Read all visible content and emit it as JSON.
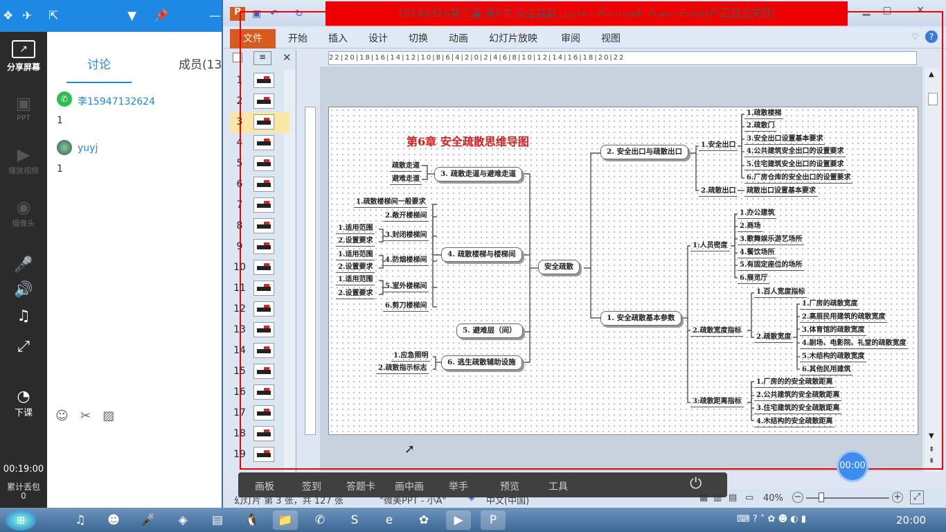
{
  "left_panel": {
    "share_label": "分享屏幕",
    "ppt_label": "PPT",
    "video_label": "播放视频",
    "camera_label": "摄像头",
    "end_class_label": "下课",
    "timer": "00:19:00",
    "subinfo1": "累计丢包",
    "subinfo2": "0",
    "tab_discuss": "讨论",
    "tab_members": "成员(13",
    "messages": [
      {
        "name": "李15947132624",
        "body": "1"
      },
      {
        "name": "yuyj",
        "body": "1"
      }
    ]
  },
  "ppt": {
    "window_title": "20180926第二篇 第6章 安全疏散 .pptx - Microsoft PowerPoint(产品激活失败)",
    "file_tab": "文件",
    "tabs": [
      "开始",
      "插入",
      "设计",
      "切换",
      "动画",
      "幻灯片放映",
      "审阅",
      "视图"
    ],
    "ruler_h": "22|20|18|16|14|12|10|8|6|4|2|0|2|4|6|8|10|12|14|16|18|20|22",
    "slide_numbers": [
      "1",
      "2",
      "3",
      "4",
      "5",
      "6",
      "7",
      "8",
      "9",
      "10",
      "11",
      "12",
      "13",
      "14",
      "15",
      "16",
      "17",
      "18",
      "19"
    ],
    "status": {
      "slide_info": "幻灯片 第 3 张，共 127 张",
      "theme": "\"微美PPT - 小A\"",
      "lang": "中文(中国)",
      "zoom": "40%"
    },
    "rec_timer": "00:00"
  },
  "bottom_bar": {
    "items": [
      "画板",
      "签到",
      "答题卡",
      "画中画",
      "举手",
      "预览",
      "工具"
    ]
  },
  "taskbar": {
    "clock": "20:00"
  },
  "mindmap": {
    "title": "第6章 安全疏散思维导图",
    "center": "安全疏散",
    "left_branches": {
      "b3": "3. 疏散走道与避难走道",
      "b3_children": [
        "疏散走道",
        "避难走道"
      ],
      "b4": "4. 疏散楼梯与楼梯间",
      "b4_children": [
        "1.疏散楼梯间一般要求",
        "2.敞开楼梯间",
        "3.封闭楼梯间",
        "4.防烟楼梯间",
        "5.室外楼梯间",
        "6.剪刀楼梯间"
      ],
      "b4_sub": [
        "1.适用范围",
        "2.设置要求",
        "1.适用范围",
        "2.设置要求",
        "1.适用范围",
        "2.设置要求"
      ],
      "b5": "5. 避难层（间）",
      "b6": "6. 逃生疏散辅助设施",
      "b6_children": [
        "1.应急照明",
        "2.疏散指示标志"
      ]
    },
    "right_branches": {
      "b2": "2. 安全出口与疏散出口",
      "b2_sub": [
        "1.安全出口",
        "2.疏散出口"
      ],
      "b2_exit": [
        "1.疏散楼梯",
        "2.疏散门",
        "3.安全出口设置基本要求",
        "4.公共建筑安全出口的设置要求",
        "5.住宅建筑安全出口的设置要求",
        "6.厂房仓库的安全出口的设置要求"
      ],
      "b2_evac": "疏散出口设置基本要求",
      "b1": "1. 安全疏散基本参数",
      "b1_sub": [
        "1:人员密度",
        "2.疏散宽度指标",
        "3:疏散距离指标"
      ],
      "density": [
        "1.办公建筑",
        "2.商场",
        "3.歌舞娱乐游艺场所",
        "4.餐饮场所",
        "5.有固定座位的场所",
        "6.展览厅"
      ],
      "width_sub": [
        "1.百人宽度指标",
        "2.疏散宽度"
      ],
      "width_items": [
        "1.厂房的疏散宽度",
        "2.高层民用建筑的疏散宽度",
        "3.体育馆的疏散宽度",
        "4.剧场、电影院、礼堂的疏散宽度",
        "5.木结构的疏散宽度",
        "6.其他民用建筑"
      ],
      "distance": [
        "1.厂房的的安全疏散距离",
        "2.公共建筑的安全疏散距离",
        "3.住宅建筑的安全疏散距离",
        "4.木结构的安全疏散距离"
      ]
    }
  }
}
